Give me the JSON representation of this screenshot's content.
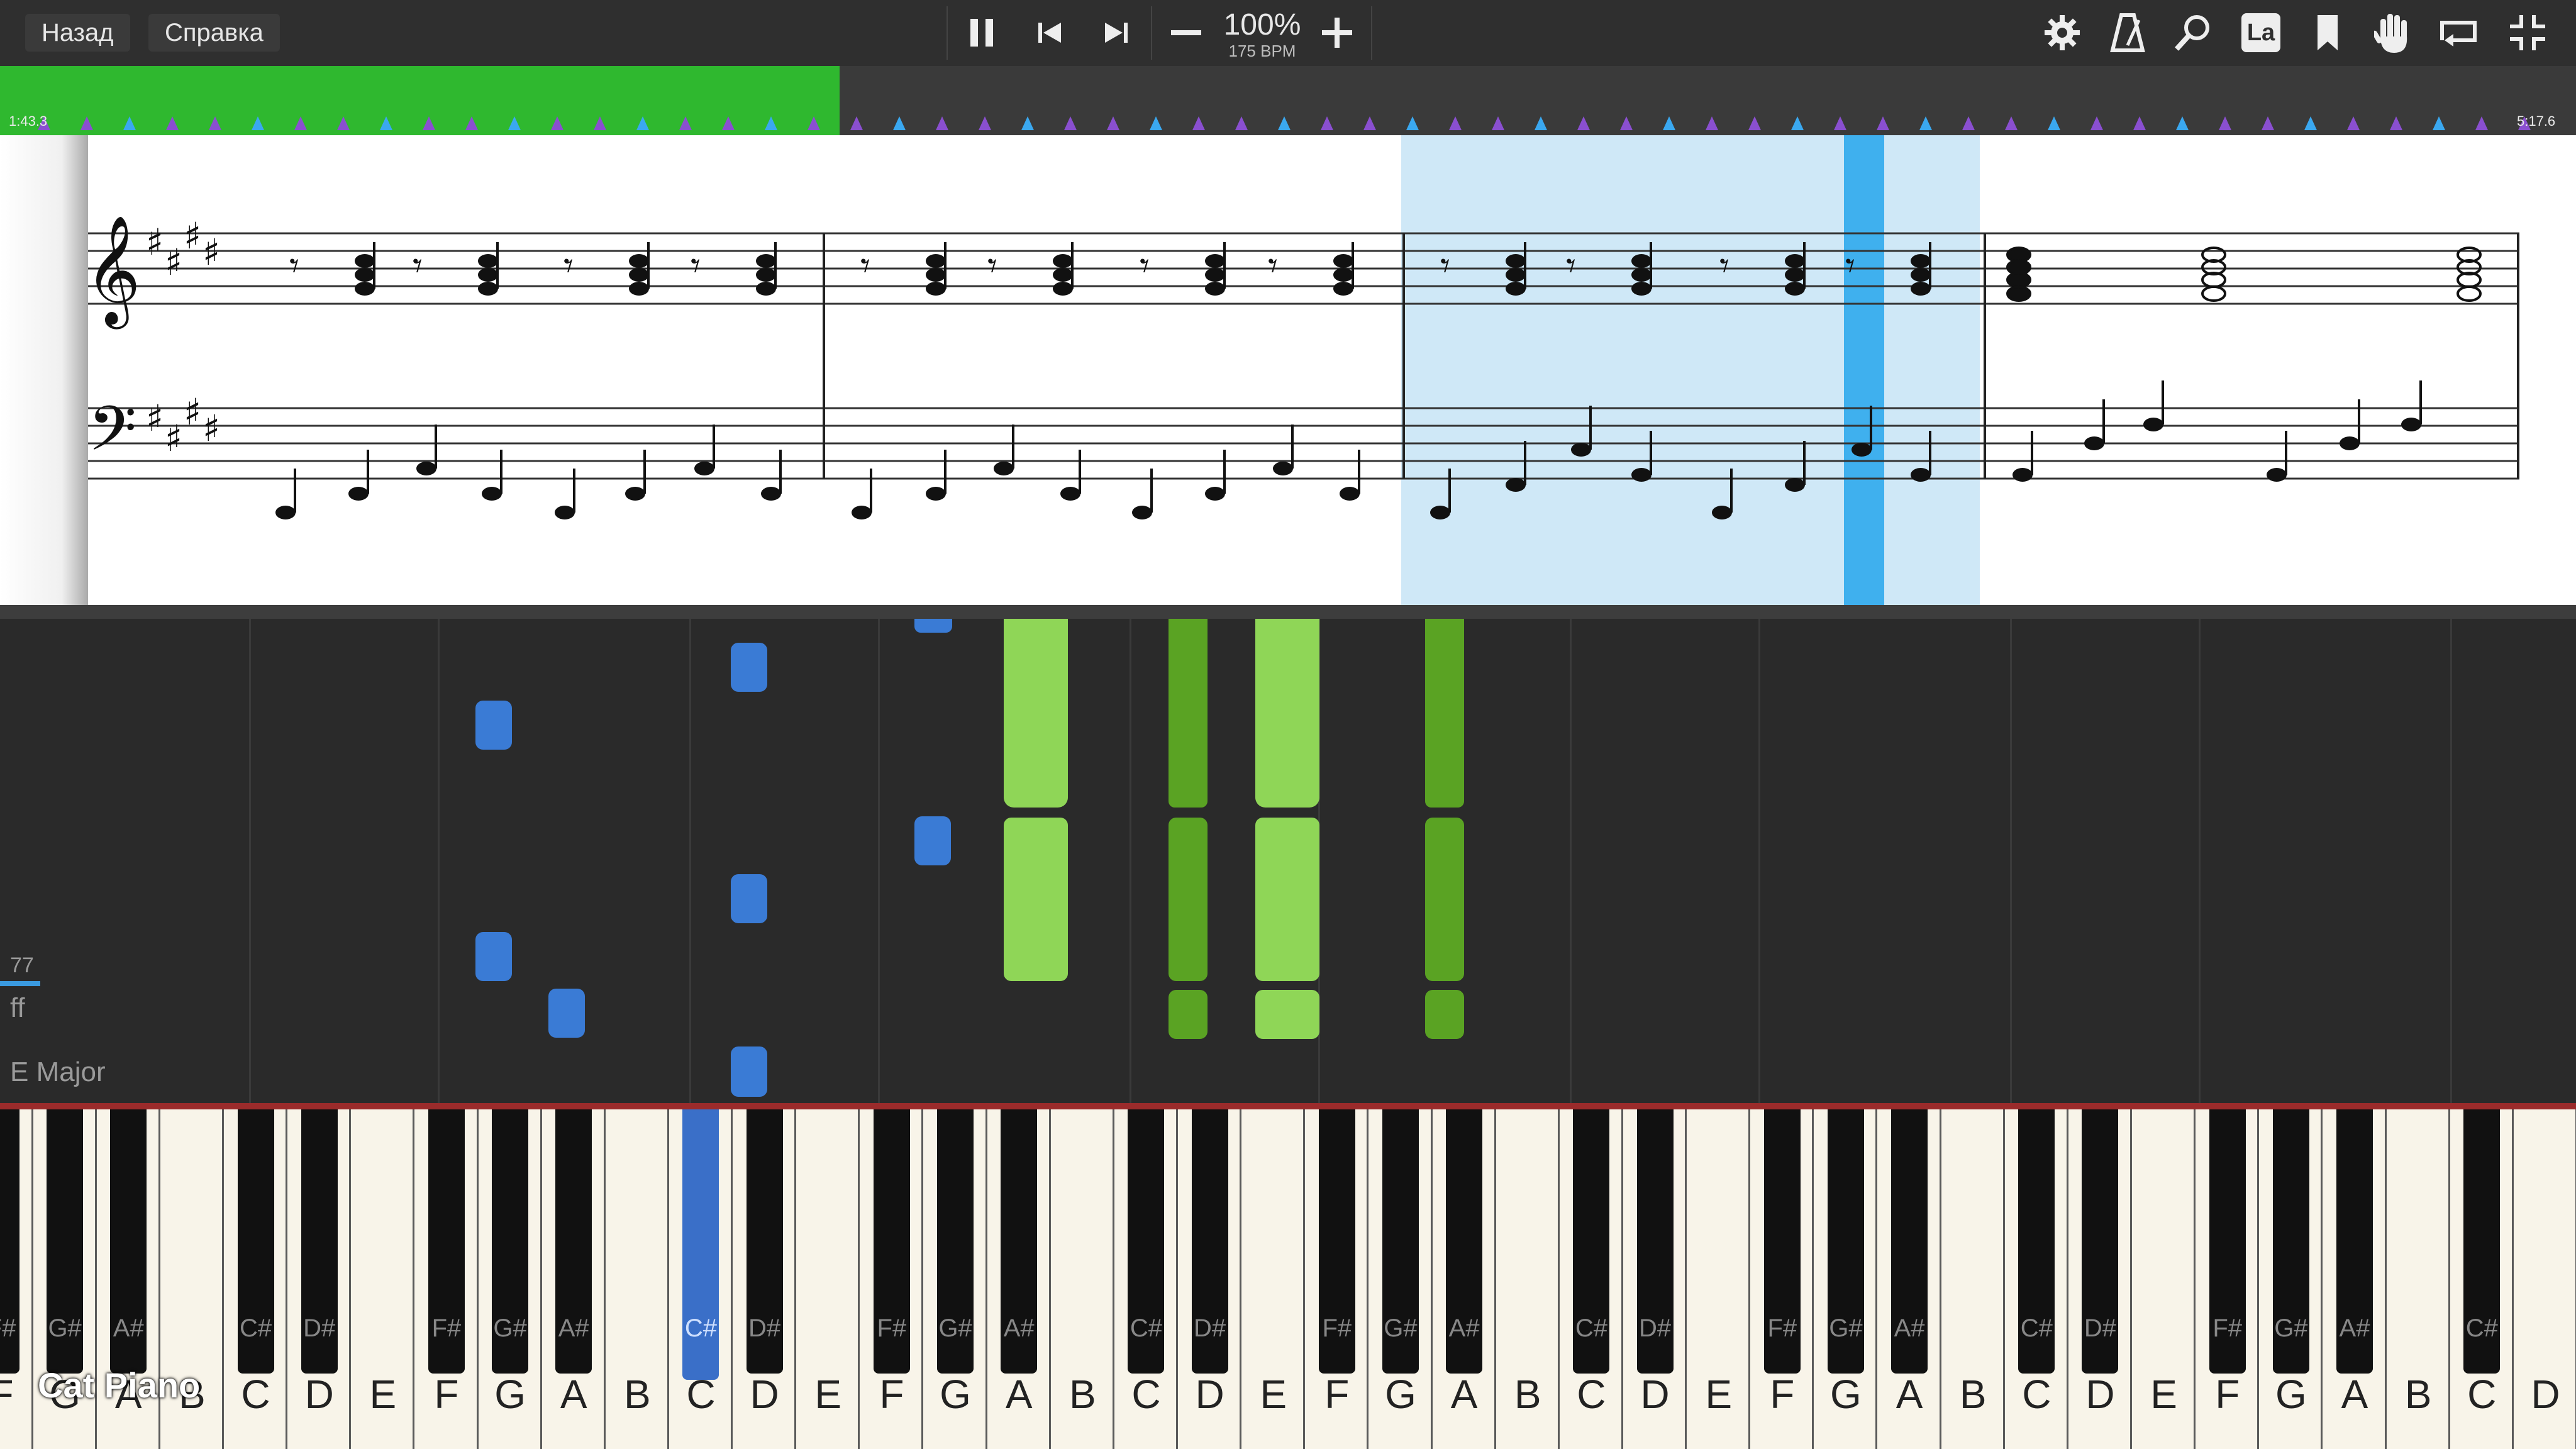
{
  "toolbar": {
    "back_label": "Назад",
    "help_label": "Справка",
    "tempo_percent": "100%",
    "tempo_bpm": "175 BPM",
    "lyrics_label": "La"
  },
  "timeline": {
    "start_time": "1:43.3",
    "end_time": "5:17.6",
    "progress_fraction": 0.326
  },
  "side_labels": {
    "velocity": "77",
    "dynamic": "ff",
    "key_signature": "E Major"
  },
  "keyboard": {
    "white_keys": [
      "F",
      "G",
      "A",
      "B",
      "C",
      "D",
      "E",
      "F",
      "G",
      "A",
      "B",
      "C",
      "D",
      "E",
      "F",
      "G",
      "A",
      "B",
      "C",
      "D",
      "E",
      "F",
      "G",
      "A",
      "B",
      "C",
      "D",
      "E",
      "F",
      "G",
      "A",
      "B",
      "C",
      "D",
      "E",
      "F",
      "G",
      "A",
      "B",
      "C",
      "D"
    ],
    "black_keys": [
      "F#",
      "G#",
      "A#",
      "C#",
      "D#",
      "F#",
      "G#",
      "A#",
      "C#",
      "D#",
      "F#",
      "G#",
      "A#",
      "C#",
      "D#",
      "F#",
      "G#",
      "A#",
      "C#",
      "D#",
      "F#",
      "G#",
      "A#",
      "C#",
      "D#",
      "F#",
      "G#",
      "A#",
      "C#"
    ],
    "active_key": "C#"
  },
  "watermark": "Cat Piano",
  "colors": {
    "progress": "#2fb82f",
    "highlight": "#cfe8f7",
    "cursor": "#3fb0ee",
    "note_blue": "#3a7bd5",
    "note_light_green": "#8fd657",
    "note_dark_green": "#5aa323"
  }
}
